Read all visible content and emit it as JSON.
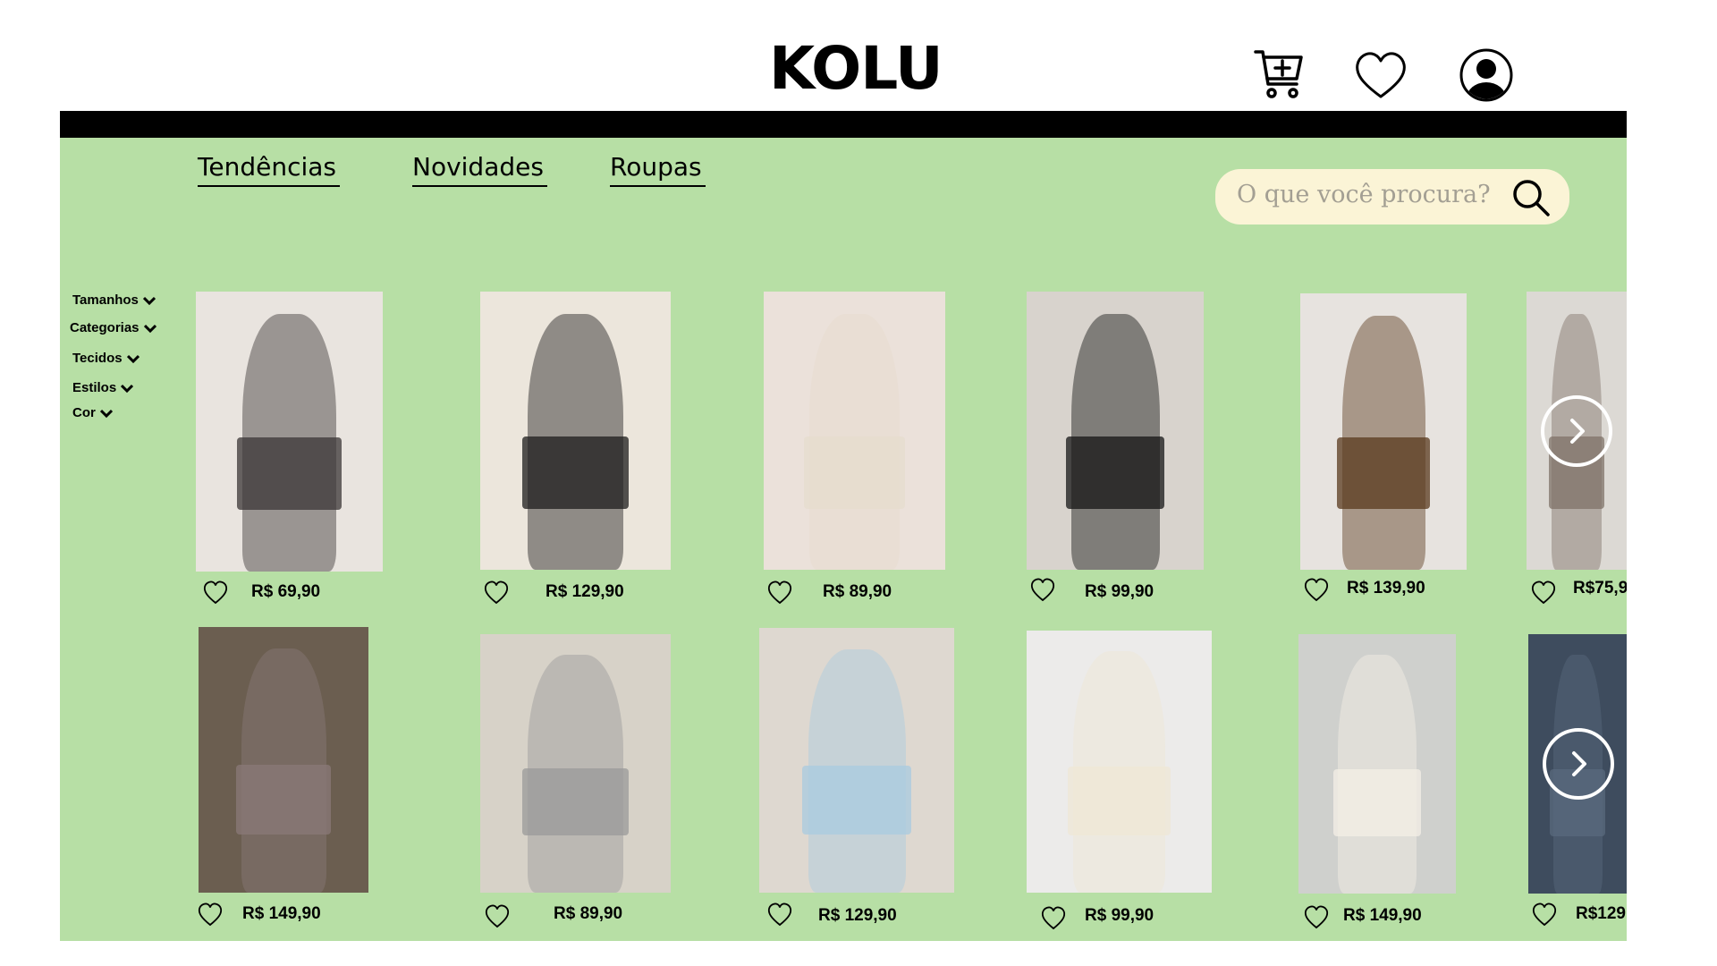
{
  "header": {
    "logo": "KOLU",
    "icons": [
      "cart-add-icon",
      "heart-icon",
      "user-icon"
    ]
  },
  "nav": {
    "links": [
      "Tendências",
      "Novidades",
      "Roupas"
    ]
  },
  "search": {
    "placeholder": "O que você procura?"
  },
  "filters": [
    "Tamanhos",
    "Categorias",
    "Tecidos",
    "Estilos",
    "Cor"
  ],
  "products": {
    "row1": [
      {
        "price": "R$ 69,90",
        "colors": [
          "#e9e4df",
          "#3a3535"
        ]
      },
      {
        "price": "R$ 129,90",
        "colors": [
          "#ece6dc",
          "#1e1c1c"
        ]
      },
      {
        "price": "R$ 89,90",
        "colors": [
          "#ebe1da",
          "#e6dccd"
        ]
      },
      {
        "price": "R$ 99,90",
        "colors": [
          "#d8d3cd",
          "#151515"
        ]
      },
      {
        "price": "R$ 139,90",
        "colors": [
          "#e7e3df",
          "#5a3a1e"
        ]
      },
      {
        "price": "R$75,9",
        "colors": [
          "#dcd9d4",
          "#7f7268"
        ]
      }
    ],
    "row2": [
      {
        "price": "R$ 149,90",
        "colors": [
          "#6b5e50",
          "#8a7a78"
        ]
      },
      {
        "price": "R$ 89,90",
        "colors": [
          "#d7d2c8",
          "#9a9a9a"
        ]
      },
      {
        "price": "R$ 129,90",
        "colors": [
          "#ded8d0",
          "#a8cbe0"
        ]
      },
      {
        "price": "R$ 99,90",
        "colors": [
          "#ecebea",
          "#efe7d5"
        ]
      },
      {
        "price": "R$ 149,90",
        "colors": [
          "#cfd0cd",
          "#f4efe6"
        ]
      },
      {
        "price": "R$129",
        "colors": [
          "#3e4c5e",
          "#596a7e"
        ]
      }
    ]
  },
  "carousel": {
    "next_icon": "chevron-right-icon"
  },
  "colors": {
    "panel": "#b7dfa5",
    "bar": "#000000",
    "search_bg": "#fbf4d6",
    "search_placeholder": "#a39f93"
  }
}
